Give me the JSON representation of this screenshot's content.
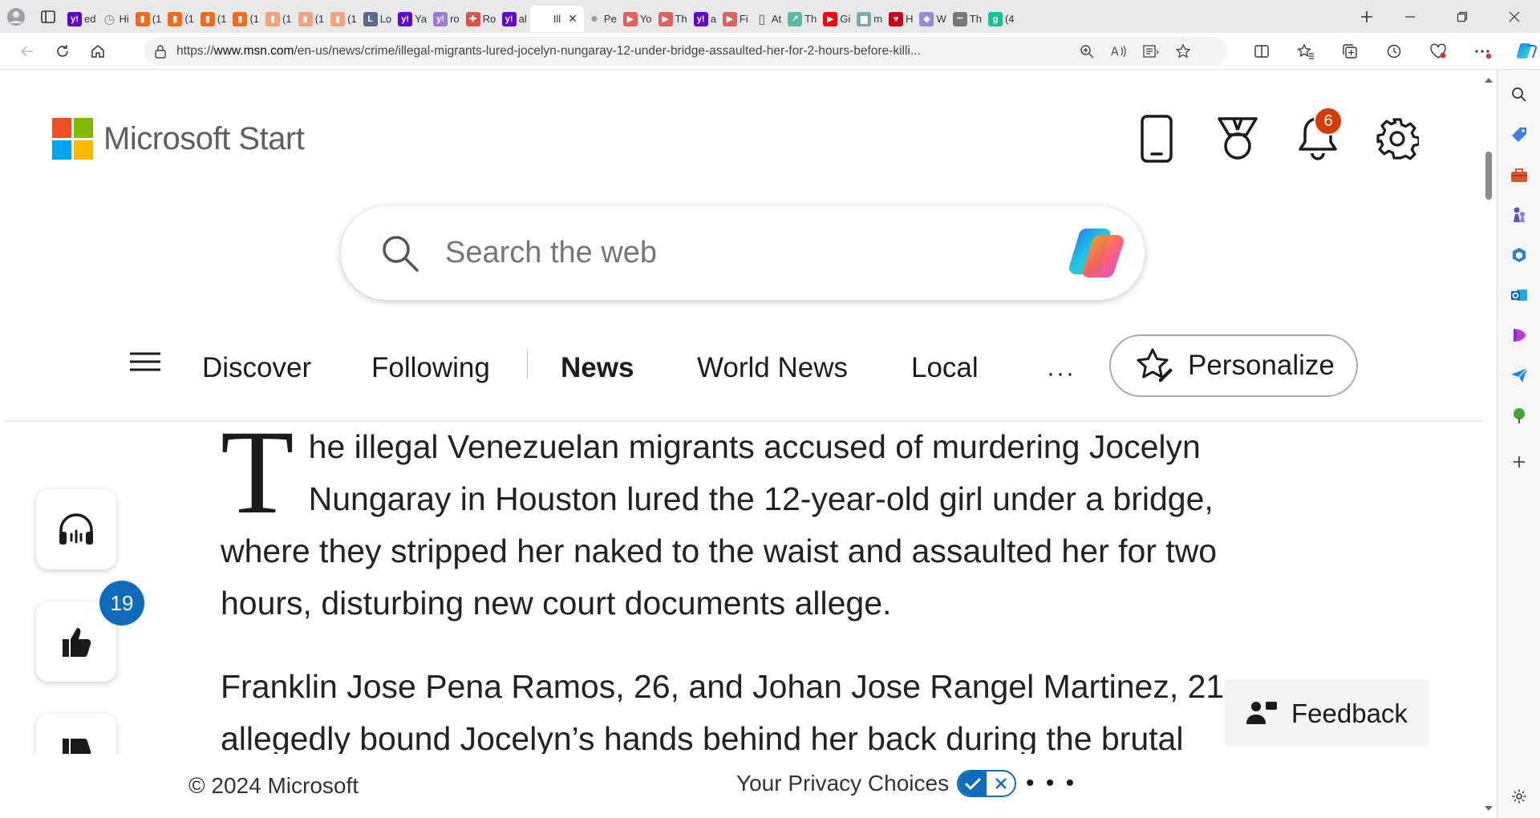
{
  "browser": {
    "tabs": [
      {
        "label": "ed",
        "icon": "yahoo-icon",
        "color": "#6001d2"
      },
      {
        "label": "Hi",
        "icon": "history-icon",
        "color": "#888888"
      },
      {
        "label": "(1",
        "icon": "bookmark-icon",
        "color": "#f26a1b"
      },
      {
        "label": "(1",
        "icon": "bookmark-icon",
        "color": "#f26a1b"
      },
      {
        "label": "(1",
        "icon": "bookmark-icon",
        "color": "#f26a1b"
      },
      {
        "label": "(1",
        "icon": "bookmark-icon",
        "color": "#f26a1b"
      },
      {
        "label": "(1",
        "icon": "bookmark-icon",
        "color": "#f3a27a"
      },
      {
        "label": "(1",
        "icon": "bookmark-icon",
        "color": "#f3a27a"
      },
      {
        "label": "(1",
        "icon": "bookmark-icon",
        "color": "#f3a27a"
      },
      {
        "label": "Lo",
        "icon": "letter-l-icon",
        "color": "#5a6b8c"
      },
      {
        "label": "Ya",
        "icon": "yahoo-icon",
        "color": "#6001d2"
      },
      {
        "label": "ro",
        "icon": "yahoo-icon",
        "color": "#9c7bd6"
      },
      {
        "label": "Ro",
        "icon": "puzzle-icon",
        "color": "#d9534f"
      },
      {
        "label": "al",
        "icon": "yahoo-icon",
        "color": "#6001d2"
      },
      {
        "label": "Ill",
        "icon": "msn-icon",
        "color": "#ffffff",
        "active": true
      },
      {
        "label": "Pe",
        "icon": "profile-icon",
        "color": "#9a9a9a"
      },
      {
        "label": "Yo",
        "icon": "youtube-icon",
        "color": "#e06060"
      },
      {
        "label": "Th",
        "icon": "youtube-icon",
        "color": "#e06060"
      },
      {
        "label": "a",
        "icon": "yahoo-icon",
        "color": "#6001d2"
      },
      {
        "label": "Fi",
        "icon": "youtube-icon",
        "color": "#e06060"
      },
      {
        "label": "At",
        "icon": "document-icon",
        "color": "#555555"
      },
      {
        "label": "Th",
        "icon": "arrow-icon",
        "color": "#5fb8a8"
      },
      {
        "label": "Gi",
        "icon": "youtube-icon",
        "color": "#ff0000"
      },
      {
        "label": "m",
        "icon": "chart-icon",
        "color": "#7aa7b5"
      },
      {
        "label": "H",
        "icon": "heart-icon",
        "color": "#d0021b"
      },
      {
        "label": "W",
        "icon": "shield-icon",
        "color": "#8f8fd8"
      },
      {
        "label": "Th",
        "icon": "dots-icon",
        "color": "#777777"
      },
      {
        "label": "(4",
        "icon": "grammarly-icon",
        "color": "#15c39a"
      }
    ],
    "url_prefix": "https://",
    "url_host": "www.msn.com",
    "url_path": "/en-us/news/crime/illegal-migrants-lured-jocelyn-nungaray-12-under-bridge-assaulted-her-for-2-hours-before-killi..."
  },
  "header": {
    "brand": "Microsoft Start",
    "notification_count": "6"
  },
  "search": {
    "placeholder": "Search the web"
  },
  "nav": {
    "items": [
      {
        "label": "Discover"
      },
      {
        "label": "Following"
      },
      {
        "label": "News",
        "active": true
      },
      {
        "label": "World News"
      },
      {
        "label": "Local"
      }
    ],
    "more": "···",
    "personalize": "Personalize"
  },
  "article": {
    "dropcap": "T",
    "p1_rest": "he illegal Venezuelan migrants accused of murdering Jocelyn Nungaray in Houston lured the 12-year-old girl under a bridge, where they stripped her naked to the waist and assaulted her for two hours, disturbing new court documents allege.",
    "p2": "Franklin Jose Pena Ramos, 26, and Johan Jose Rangel Martinez, 21, allegedly bound Jocelyn’s hands behind her back during the brutal"
  },
  "actions": {
    "like_count": "19"
  },
  "footer": {
    "copyright": "© 2024 Microsoft",
    "privacy": "Your Privacy Choices",
    "more": "• • •",
    "feedback": "Feedback"
  },
  "colors": {
    "ms_red": "#f25022",
    "ms_green": "#7fba00",
    "ms_blue": "#00a4ef",
    "ms_yellow": "#ffb900",
    "badge_red": "#d83b01",
    "accent_blue": "#0f6cbd"
  }
}
